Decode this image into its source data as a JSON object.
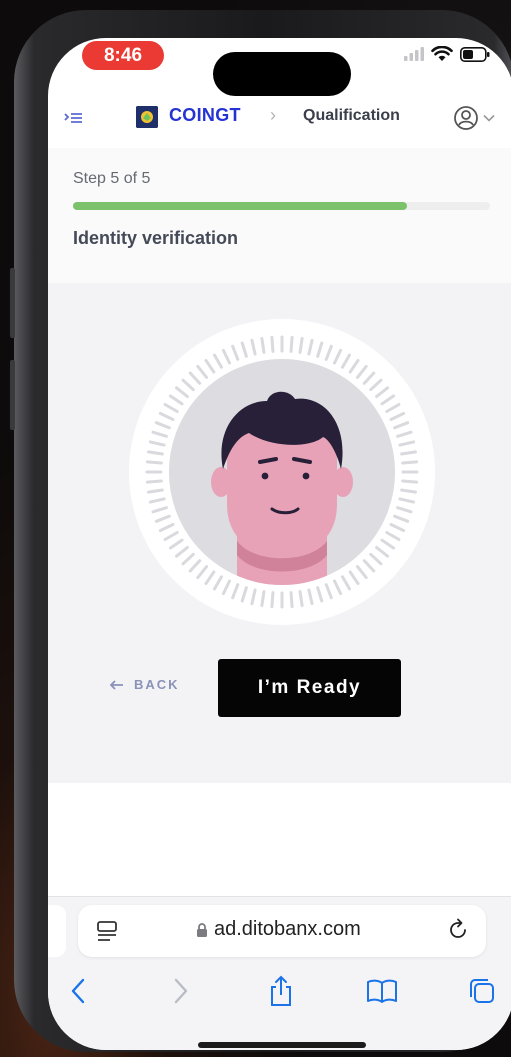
{
  "status_bar": {
    "time": "8:46"
  },
  "header": {
    "menu_icon": "indent-menu-icon",
    "brand": "COINGT",
    "crumb_separator": "›",
    "crumb": "Qualification",
    "account_icon": "account-circle-icon"
  },
  "step": {
    "label": "Step 5 of 5",
    "progress": 0.8,
    "title": "Identity verification"
  },
  "actions": {
    "back_label": "BACK",
    "ready_label": "I’m Ready"
  },
  "browser": {
    "url": "ad.ditobanx.com",
    "toolbar_icons": [
      "back-icon",
      "forward-icon",
      "share-icon",
      "bookmarks-icon",
      "tabs-icon"
    ]
  },
  "colors": {
    "brand": "#2532d4",
    "progress": "#7cc26a",
    "time_pill": "#ea3a33",
    "primary_button": "#050505",
    "ios_blue": "#1a73e8"
  }
}
